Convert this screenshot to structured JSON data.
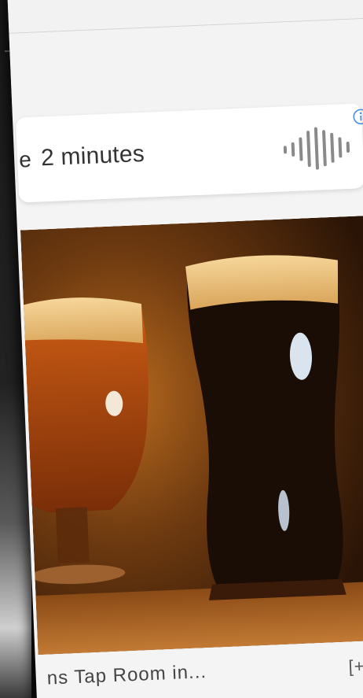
{
  "audio_player": {
    "prefix_fragment": "e",
    "duration": "2 minutes",
    "waveform_icon": "waveform-icon",
    "info_icon": "info-icon",
    "accent_color": "#4a8fe0"
  },
  "article_image": {
    "subject": "Two glasses of beer on a wooden bar"
  },
  "caption": {
    "text": "ns Tap Room in...",
    "expand_label": "[+]"
  }
}
